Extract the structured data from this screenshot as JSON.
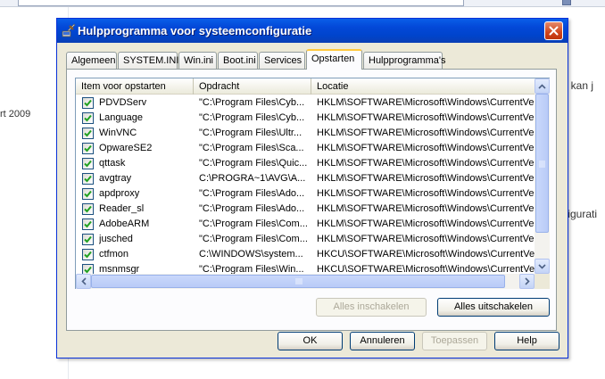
{
  "background": {
    "date_fragment": "rt 2009",
    "text_fragment_1": ", kan j",
    "text_fragment_2": "figurati"
  },
  "dialog": {
    "title": "Hulpprogramma voor systeemconfiguratie",
    "close_icon": "close-x-icon"
  },
  "tabs": [
    {
      "label": "Algemeen"
    },
    {
      "label": "SYSTEM.INI"
    },
    {
      "label": "Win.ini"
    },
    {
      "label": "Boot.ini"
    },
    {
      "label": "Services"
    },
    {
      "label": "Opstarten",
      "active": true
    },
    {
      "label": "Hulpprogramma's"
    }
  ],
  "list": {
    "columns": [
      "Item voor opstarten",
      "Opdracht",
      "Locatie"
    ],
    "rows": [
      {
        "item": "PDVDServ",
        "command": "\"C:\\Program Files\\Cyb...",
        "location": "HKLM\\SOFTWARE\\Microsoft\\Windows\\CurrentVer...",
        "checked": true
      },
      {
        "item": "Language",
        "command": "\"C:\\Program Files\\Cyb...",
        "location": "HKLM\\SOFTWARE\\Microsoft\\Windows\\CurrentVer...",
        "checked": true
      },
      {
        "item": "WinVNC",
        "command": "\"C:\\Program Files\\Ultr...",
        "location": "HKLM\\SOFTWARE\\Microsoft\\Windows\\CurrentVer...",
        "checked": true
      },
      {
        "item": "OpwareSE2",
        "command": "\"C:\\Program Files\\Sca...",
        "location": "HKLM\\SOFTWARE\\Microsoft\\Windows\\CurrentVer...",
        "checked": true
      },
      {
        "item": "qttask",
        "command": "\"C:\\Program Files\\Quic...",
        "location": "HKLM\\SOFTWARE\\Microsoft\\Windows\\CurrentVer...",
        "checked": true
      },
      {
        "item": "avgtray",
        "command": "C:\\PROGRA~1\\AVG\\A...",
        "location": "HKLM\\SOFTWARE\\Microsoft\\Windows\\CurrentVer...",
        "checked": true
      },
      {
        "item": "apdproxy",
        "command": "\"C:\\Program Files\\Ado...",
        "location": "HKLM\\SOFTWARE\\Microsoft\\Windows\\CurrentVer...",
        "checked": true
      },
      {
        "item": "Reader_sl",
        "command": "\"C:\\Program Files\\Ado...",
        "location": "HKLM\\SOFTWARE\\Microsoft\\Windows\\CurrentVer...",
        "checked": true
      },
      {
        "item": "AdobeARM",
        "command": "\"C:\\Program Files\\Com...",
        "location": "HKLM\\SOFTWARE\\Microsoft\\Windows\\CurrentVer...",
        "checked": true
      },
      {
        "item": "jusched",
        "command": "\"C:\\Program Files\\Com...",
        "location": "HKLM\\SOFTWARE\\Microsoft\\Windows\\CurrentVer...",
        "checked": true
      },
      {
        "item": "ctfmon",
        "command": "C:\\WINDOWS\\system...",
        "location": "HKCU\\SOFTWARE\\Microsoft\\Windows\\CurrentVer...",
        "checked": true
      },
      {
        "item": "msnmsgr",
        "command": "\"C:\\Program Files\\Win...",
        "location": "HKCU\\SOFTWARE\\Microsoft\\Windows\\CurrentVer...",
        "checked": true
      }
    ]
  },
  "buttons": {
    "enable_all": "Alles inschakelen",
    "disable_all": "Alles uitschakelen",
    "ok": "OK",
    "cancel": "Annuleren",
    "apply": "Toepassen",
    "help": "Help"
  },
  "colors": {
    "titlebar": "#0348d8",
    "dialog_bg": "#ece9d8",
    "check": "#21a121",
    "active_tab_accent": "#ffc83c"
  }
}
